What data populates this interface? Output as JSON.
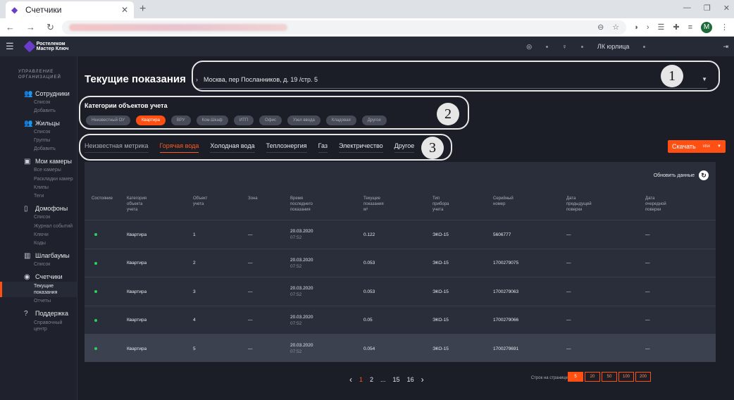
{
  "browser": {
    "tab_title": "Счетчики",
    "tab_close": "✕",
    "new_tab": "+",
    "win_controls": [
      "—",
      "❐",
      "✕"
    ],
    "back": "←",
    "forward": "→",
    "reload": "↻",
    "profile_initial": "M"
  },
  "header": {
    "logo_line1": "Ростелеком",
    "logo_line2": "Мастер Ключ",
    "account": "ЛК юрлица"
  },
  "sidebar": {
    "title": "УПРАВЛЕНИЕ ОРГАНИЗАЦИЕЙ",
    "sections": [
      {
        "label": "Сотрудники",
        "icon": "users-icon",
        "glyph": "👥",
        "items": [
          "Список",
          "Добавить"
        ]
      },
      {
        "label": "Жильцы",
        "icon": "residents-icon",
        "glyph": "👥",
        "items": [
          "Список",
          "Группы",
          "Добавить"
        ]
      },
      {
        "label": "Мои камеры",
        "icon": "camera-icon",
        "glyph": "▣",
        "items": [
          "Все камеры",
          "Раскладки камер",
          "Клипы",
          "Теги"
        ]
      },
      {
        "label": "Домофоны",
        "icon": "intercom-icon",
        "glyph": "▯",
        "items": [
          "Список",
          "Журнал событий",
          "Ключи",
          "Коды"
        ]
      },
      {
        "label": "Шлагбаумы",
        "icon": "barrier-icon",
        "glyph": "▥",
        "items": [
          "Список"
        ]
      },
      {
        "label": "Счетчики",
        "icon": "eye-icon",
        "glyph": "◉",
        "items": [
          "Текущие показания",
          "Отчеты"
        ],
        "active_item": "Текущие показания"
      },
      {
        "label": "Поддержка",
        "icon": "help-icon",
        "glyph": "?",
        "items": [
          "Справочный центр"
        ]
      }
    ]
  },
  "page": {
    "title": "Текущие показания",
    "address": "Москва, пер Посланников, д. 19 /стр. 5",
    "annotations": [
      "1",
      "2",
      "3"
    ],
    "categories_title": "Категории объектов учета",
    "categories": [
      "Неизвестный ОУ",
      "Квартира",
      "ВРУ",
      "Ком.Шкаф",
      "ИТП",
      "Офис",
      "Узел ввода",
      "Кладовая",
      "Другое"
    ],
    "active_category": "Квартира",
    "metric_tabs": [
      "Неизвестная метрика",
      "Горячая вода",
      "Холодная вода",
      "Теплоэнергия",
      "Газ",
      "Электричество",
      "Другое"
    ],
    "active_metric": "Горячая вода",
    "download_label": "Скачать",
    "download_format": "xlsx",
    "refresh_label": "Обновить данные"
  },
  "table": {
    "headers": [
      "Состояние",
      "Категория\nобъекта\nучета",
      "Объект\nучета",
      "Зона",
      "Время\nпоследнего\nпоказания",
      "Текущие\nпоказания\nм³",
      "Тип\nприбора\nучета",
      "Серийный\nномер",
      "Дата\nпредыдущей\nповерки",
      "Дата\nочередной\nповерки"
    ],
    "rows": [
      {
        "category": "Квартира",
        "object": "1",
        "zone": "—",
        "date": "20.03.2020",
        "time": "07:52",
        "value": "0.122",
        "type": "ЭКО-15",
        "serial": "5606777",
        "prev": "—",
        "next": "—"
      },
      {
        "category": "Квартира",
        "object": "2",
        "zone": "—",
        "date": "20.03.2020",
        "time": "07:52",
        "value": "0.053",
        "type": "ЭКО-15",
        "serial": "1700279075",
        "prev": "—",
        "next": "—"
      },
      {
        "category": "Квартира",
        "object": "3",
        "zone": "—",
        "date": "20.03.2020",
        "time": "07:52",
        "value": "0.053",
        "type": "ЭКО-15",
        "serial": "1700279063",
        "prev": "—",
        "next": "—"
      },
      {
        "category": "Квартира",
        "object": "4",
        "zone": "—",
        "date": "20.03.2020",
        "time": "07:52",
        "value": "0.05",
        "type": "ЭКО-15",
        "serial": "1700279066",
        "prev": "—",
        "next": "—"
      },
      {
        "category": "Квартира",
        "object": "5",
        "zone": "—",
        "date": "20.03.2020",
        "time": "07:52",
        "value": "0.054",
        "type": "ЭКО-15",
        "serial": "1700279691",
        "prev": "—",
        "next": "—"
      }
    ]
  },
  "pagination": {
    "pages": [
      "1",
      "2",
      "...",
      "15",
      "16"
    ],
    "current": "1",
    "prev": "‹",
    "next": "›",
    "per_page_label": "Строк на странице",
    "sizes": [
      "5",
      "20",
      "50",
      "100",
      "200"
    ],
    "active_size": "5"
  },
  "colors": {
    "accent": "#ff4f12",
    "status_ok": "#2ed15a",
    "panel": "#2a2e3a"
  }
}
